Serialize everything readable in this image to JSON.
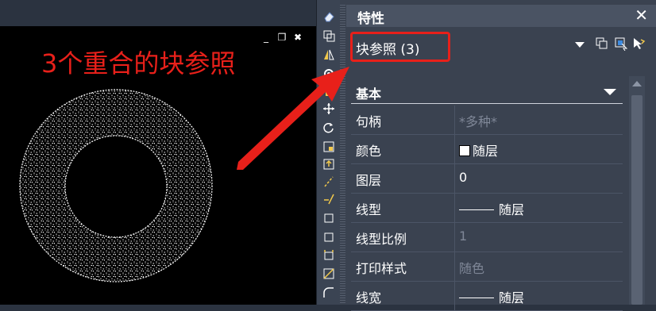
{
  "canvas": {
    "annotation": "3个重合的块参照",
    "window_controls": [
      "_",
      "❐",
      "✖"
    ]
  },
  "toolbar": {
    "tools": [
      "eraser-icon",
      "copy-icon",
      "mirror-icon",
      "offset-icon",
      "array-icon",
      "move-icon",
      "rotate-icon",
      "scale-icon",
      "stretch-icon",
      "trim-icon",
      "extend-icon",
      "break-at-point-icon",
      "break-icon",
      "join-icon",
      "chamfer-icon",
      "fillet-icon"
    ]
  },
  "properties": {
    "title": "特性",
    "close": "✕",
    "selection": "块参照 (3)",
    "section": "基本",
    "rows": [
      {
        "label": "句柄",
        "value": "*多种*",
        "dim": true
      },
      {
        "label": "颜色",
        "value": "随层",
        "swatch": "#ffffff"
      },
      {
        "label": "图层",
        "value": "0"
      },
      {
        "label": "线型",
        "value": "随层",
        "line": true
      },
      {
        "label": "线型比例",
        "value": "1",
        "dim": true
      },
      {
        "label": "打印样式",
        "value": "随色",
        "dim": true
      },
      {
        "label": "线宽",
        "value": "随层",
        "line": true
      }
    ]
  },
  "colors": {
    "annotation_red": "#e8201a",
    "panel_bg": "#3a4250",
    "canvas_bg": "#000000"
  }
}
